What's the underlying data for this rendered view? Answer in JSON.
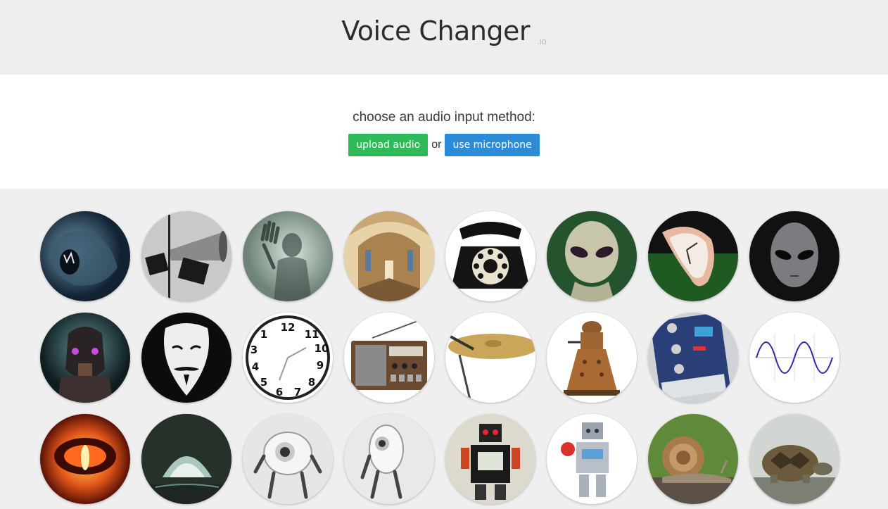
{
  "header": {
    "title": "Voice Changer",
    "suffix": ".io"
  },
  "input": {
    "prompt": "choose an audio input method:",
    "upload_label": "upload audio",
    "or_label": "or",
    "mic_label": "use microphone"
  },
  "effects": [
    [
      "monster-icon",
      "megaphone-icon",
      "ghost-icon",
      "cathedral-icon",
      "telephone-icon",
      "alien-icon",
      "melting-clock-icon",
      "grey-alien-icon"
    ],
    [
      "robot-skull-icon",
      "anonymous-mask-icon",
      "reversed-clock-icon",
      "radio-icon",
      "cymbal-icon",
      "dalek-icon",
      "guitar-pedal-icon",
      "sine-wave-icon"
    ],
    [
      "fire-eye-icon",
      "cave-icon",
      "white-robot-icon",
      "white-robot-side-icon",
      "toy-robot-icon",
      "lego-robot-icon",
      "snail-icon",
      "tortoise-icon"
    ]
  ]
}
